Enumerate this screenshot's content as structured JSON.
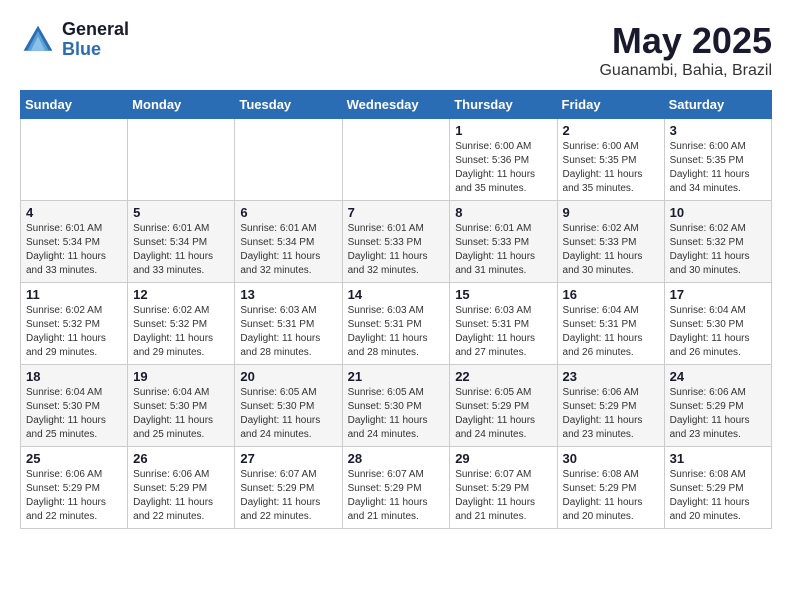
{
  "logo": {
    "general": "General",
    "blue": "Blue"
  },
  "title": "May 2025",
  "location": "Guanambi, Bahia, Brazil",
  "weekdays": [
    "Sunday",
    "Monday",
    "Tuesday",
    "Wednesday",
    "Thursday",
    "Friday",
    "Saturday"
  ],
  "weeks": [
    [
      {
        "day": "",
        "info": ""
      },
      {
        "day": "",
        "info": ""
      },
      {
        "day": "",
        "info": ""
      },
      {
        "day": "",
        "info": ""
      },
      {
        "day": "1",
        "info": "Sunrise: 6:00 AM\nSunset: 5:36 PM\nDaylight: 11 hours\nand 35 minutes."
      },
      {
        "day": "2",
        "info": "Sunrise: 6:00 AM\nSunset: 5:35 PM\nDaylight: 11 hours\nand 35 minutes."
      },
      {
        "day": "3",
        "info": "Sunrise: 6:00 AM\nSunset: 5:35 PM\nDaylight: 11 hours\nand 34 minutes."
      }
    ],
    [
      {
        "day": "4",
        "info": "Sunrise: 6:01 AM\nSunset: 5:34 PM\nDaylight: 11 hours\nand 33 minutes."
      },
      {
        "day": "5",
        "info": "Sunrise: 6:01 AM\nSunset: 5:34 PM\nDaylight: 11 hours\nand 33 minutes."
      },
      {
        "day": "6",
        "info": "Sunrise: 6:01 AM\nSunset: 5:34 PM\nDaylight: 11 hours\nand 32 minutes."
      },
      {
        "day": "7",
        "info": "Sunrise: 6:01 AM\nSunset: 5:33 PM\nDaylight: 11 hours\nand 32 minutes."
      },
      {
        "day": "8",
        "info": "Sunrise: 6:01 AM\nSunset: 5:33 PM\nDaylight: 11 hours\nand 31 minutes."
      },
      {
        "day": "9",
        "info": "Sunrise: 6:02 AM\nSunset: 5:33 PM\nDaylight: 11 hours\nand 30 minutes."
      },
      {
        "day": "10",
        "info": "Sunrise: 6:02 AM\nSunset: 5:32 PM\nDaylight: 11 hours\nand 30 minutes."
      }
    ],
    [
      {
        "day": "11",
        "info": "Sunrise: 6:02 AM\nSunset: 5:32 PM\nDaylight: 11 hours\nand 29 minutes."
      },
      {
        "day": "12",
        "info": "Sunrise: 6:02 AM\nSunset: 5:32 PM\nDaylight: 11 hours\nand 29 minutes."
      },
      {
        "day": "13",
        "info": "Sunrise: 6:03 AM\nSunset: 5:31 PM\nDaylight: 11 hours\nand 28 minutes."
      },
      {
        "day": "14",
        "info": "Sunrise: 6:03 AM\nSunset: 5:31 PM\nDaylight: 11 hours\nand 28 minutes."
      },
      {
        "day": "15",
        "info": "Sunrise: 6:03 AM\nSunset: 5:31 PM\nDaylight: 11 hours\nand 27 minutes."
      },
      {
        "day": "16",
        "info": "Sunrise: 6:04 AM\nSunset: 5:31 PM\nDaylight: 11 hours\nand 26 minutes."
      },
      {
        "day": "17",
        "info": "Sunrise: 6:04 AM\nSunset: 5:30 PM\nDaylight: 11 hours\nand 26 minutes."
      }
    ],
    [
      {
        "day": "18",
        "info": "Sunrise: 6:04 AM\nSunset: 5:30 PM\nDaylight: 11 hours\nand 25 minutes."
      },
      {
        "day": "19",
        "info": "Sunrise: 6:04 AM\nSunset: 5:30 PM\nDaylight: 11 hours\nand 25 minutes."
      },
      {
        "day": "20",
        "info": "Sunrise: 6:05 AM\nSunset: 5:30 PM\nDaylight: 11 hours\nand 24 minutes."
      },
      {
        "day": "21",
        "info": "Sunrise: 6:05 AM\nSunset: 5:30 PM\nDaylight: 11 hours\nand 24 minutes."
      },
      {
        "day": "22",
        "info": "Sunrise: 6:05 AM\nSunset: 5:29 PM\nDaylight: 11 hours\nand 24 minutes."
      },
      {
        "day": "23",
        "info": "Sunrise: 6:06 AM\nSunset: 5:29 PM\nDaylight: 11 hours\nand 23 minutes."
      },
      {
        "day": "24",
        "info": "Sunrise: 6:06 AM\nSunset: 5:29 PM\nDaylight: 11 hours\nand 23 minutes."
      }
    ],
    [
      {
        "day": "25",
        "info": "Sunrise: 6:06 AM\nSunset: 5:29 PM\nDaylight: 11 hours\nand 22 minutes."
      },
      {
        "day": "26",
        "info": "Sunrise: 6:06 AM\nSunset: 5:29 PM\nDaylight: 11 hours\nand 22 minutes."
      },
      {
        "day": "27",
        "info": "Sunrise: 6:07 AM\nSunset: 5:29 PM\nDaylight: 11 hours\nand 22 minutes."
      },
      {
        "day": "28",
        "info": "Sunrise: 6:07 AM\nSunset: 5:29 PM\nDaylight: 11 hours\nand 21 minutes."
      },
      {
        "day": "29",
        "info": "Sunrise: 6:07 AM\nSunset: 5:29 PM\nDaylight: 11 hours\nand 21 minutes."
      },
      {
        "day": "30",
        "info": "Sunrise: 6:08 AM\nSunset: 5:29 PM\nDaylight: 11 hours\nand 20 minutes."
      },
      {
        "day": "31",
        "info": "Sunrise: 6:08 AM\nSunset: 5:29 PM\nDaylight: 11 hours\nand 20 minutes."
      }
    ]
  ]
}
